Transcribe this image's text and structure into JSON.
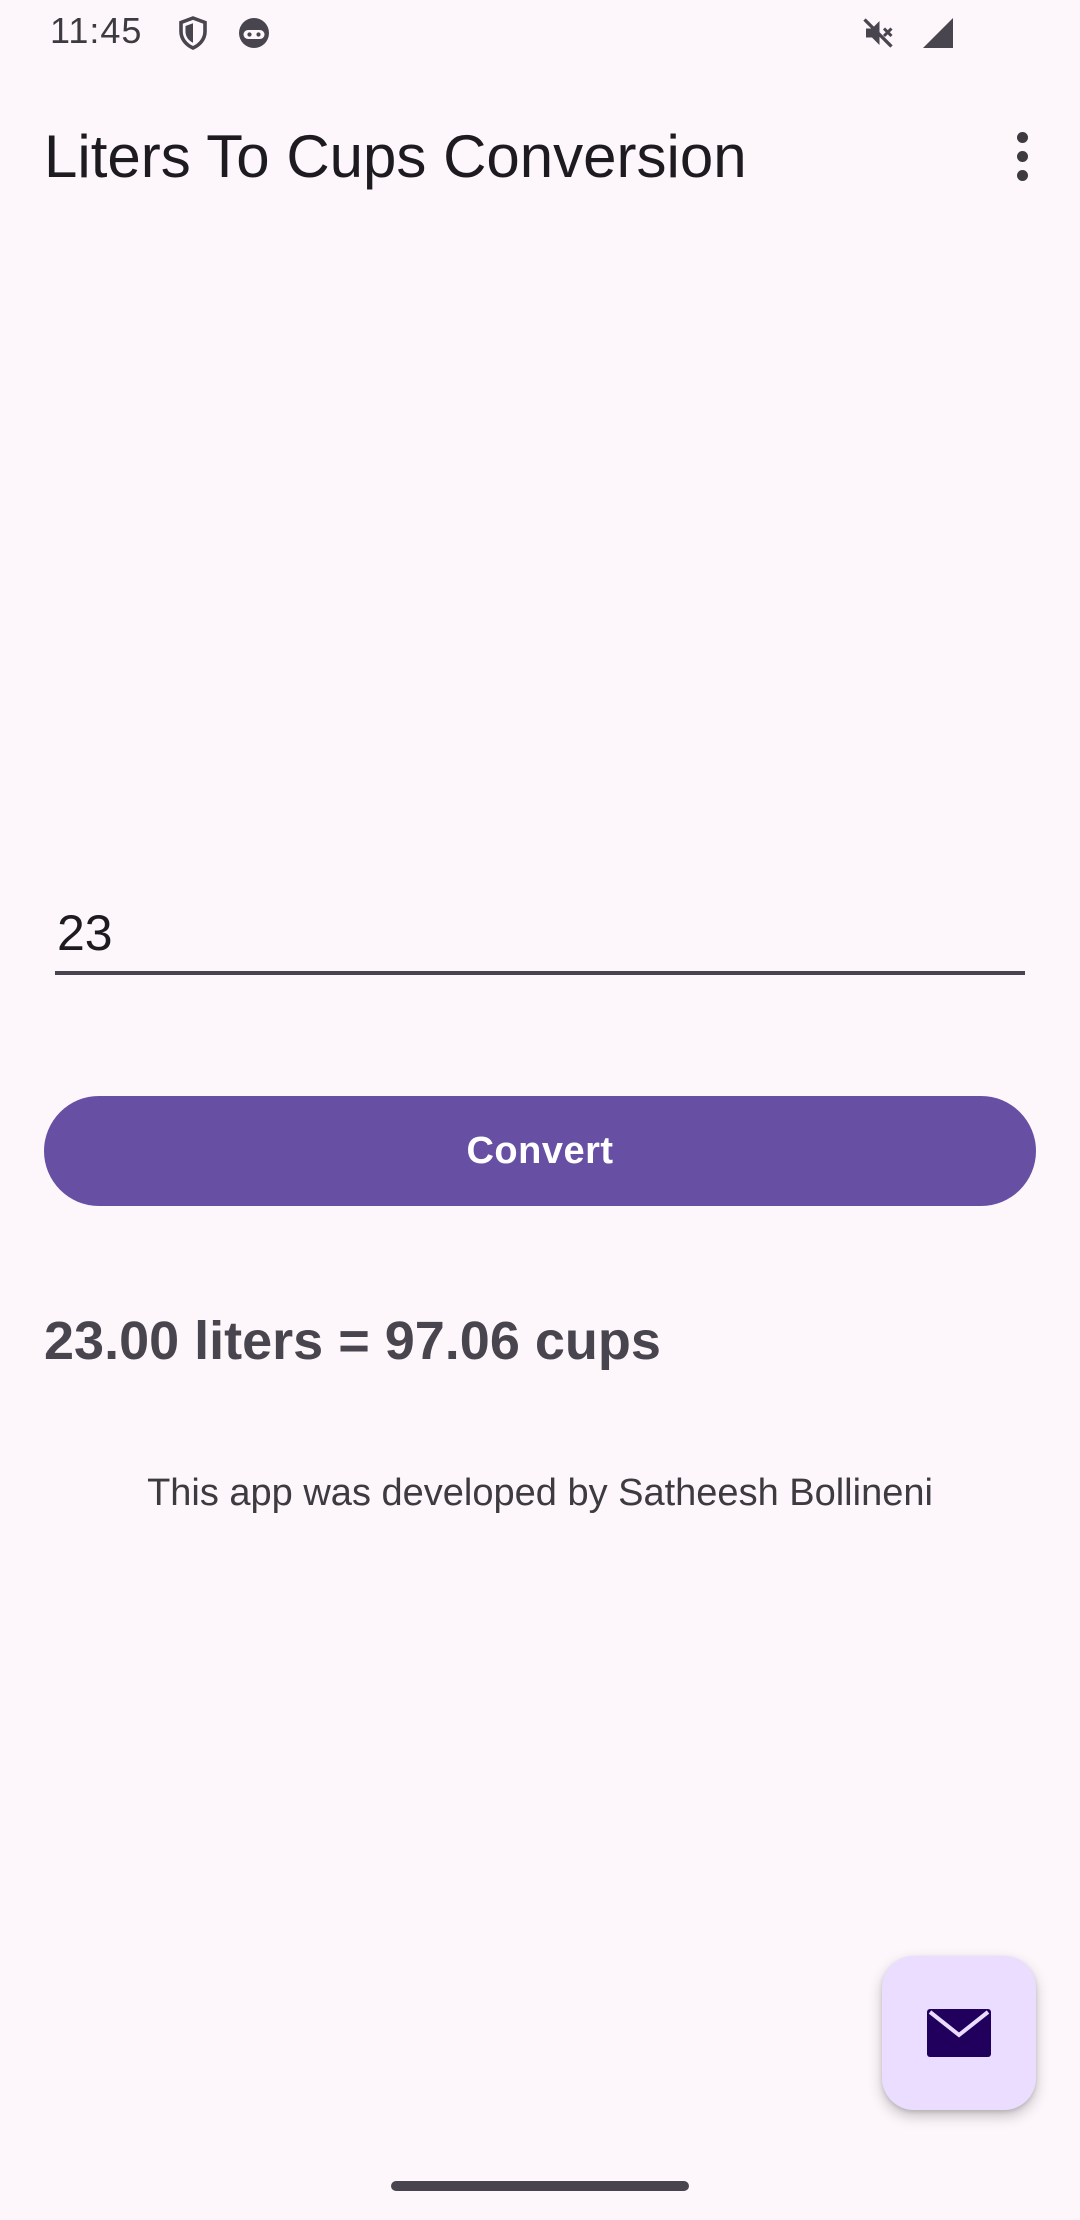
{
  "status_bar": {
    "time": "11:45",
    "icons": [
      "shield-icon",
      "android-face-icon",
      "mute-icon",
      "signal-icon"
    ]
  },
  "app_bar": {
    "title": "Liters To Cups Conversion",
    "menu_icon": "more-vert-icon"
  },
  "form": {
    "input_value": "23",
    "convert_label": "Convert"
  },
  "result": {
    "text": "23.00 liters = 97.06 cups"
  },
  "credit": {
    "text": "This app was developed by Satheesh Bollineni"
  },
  "fab": {
    "icon": "email-icon"
  },
  "colors": {
    "background": "#fdf7fb",
    "primary": "#6750a4",
    "fab_background": "#eaddff",
    "fab_icon": "#21005d"
  }
}
